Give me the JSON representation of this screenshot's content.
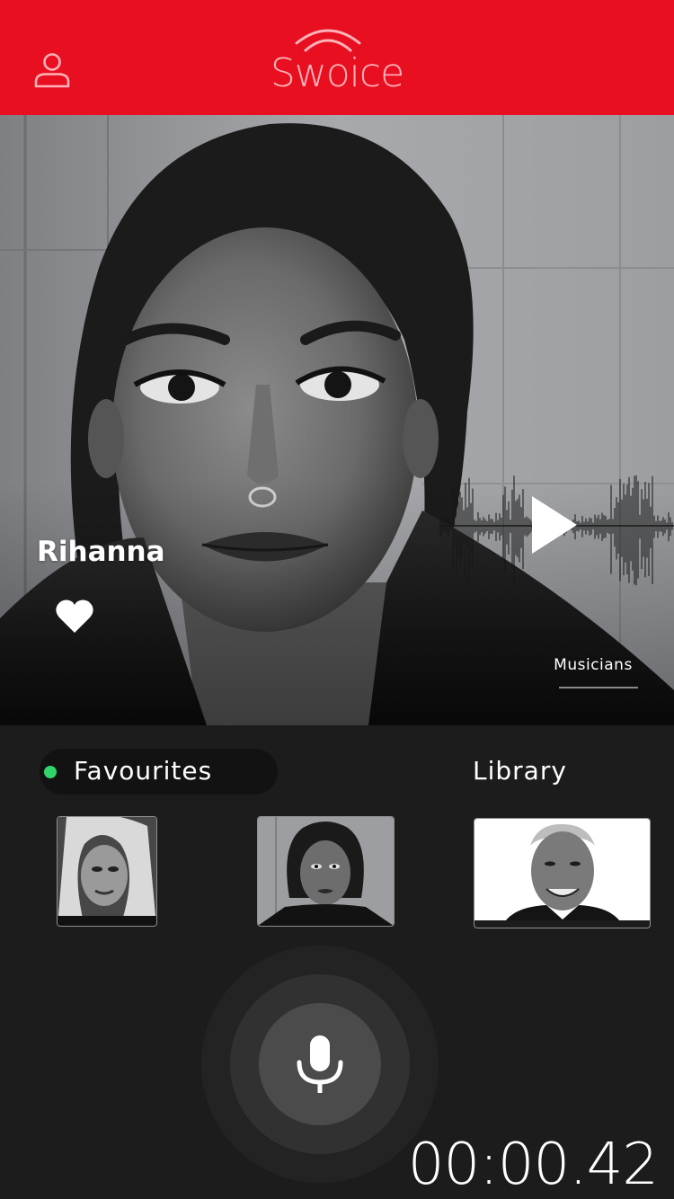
{
  "header": {
    "app_name": "Swoice",
    "profile_icon": "user-icon",
    "bg_color": "#e80f21",
    "logo_color": "#ffb3b9"
  },
  "hero": {
    "artist_name": "Rihanna",
    "favorite_icon": "heart-icon",
    "play_icon": "play-icon",
    "waveform_icon": "audio-waveform",
    "category_label": "Musicians",
    "is_favorite": true
  },
  "tabs": {
    "favourites_label": "Favourites",
    "library_label": "Library",
    "active_tab": "favourites",
    "active_dot_color": "#2fd46a"
  },
  "thumbnails": [
    {
      "subject": "blonde woman portrait",
      "selected": false
    },
    {
      "subject": "rihanna portrait",
      "selected": true
    },
    {
      "subject": "smiling older man portrait",
      "selected": false
    }
  ],
  "recorder": {
    "mic_icon": "microphone-icon",
    "elapsed": "00:00.42"
  },
  "colors": {
    "panel_bg": "#1c1c1d",
    "pill_bg": "#121212"
  }
}
